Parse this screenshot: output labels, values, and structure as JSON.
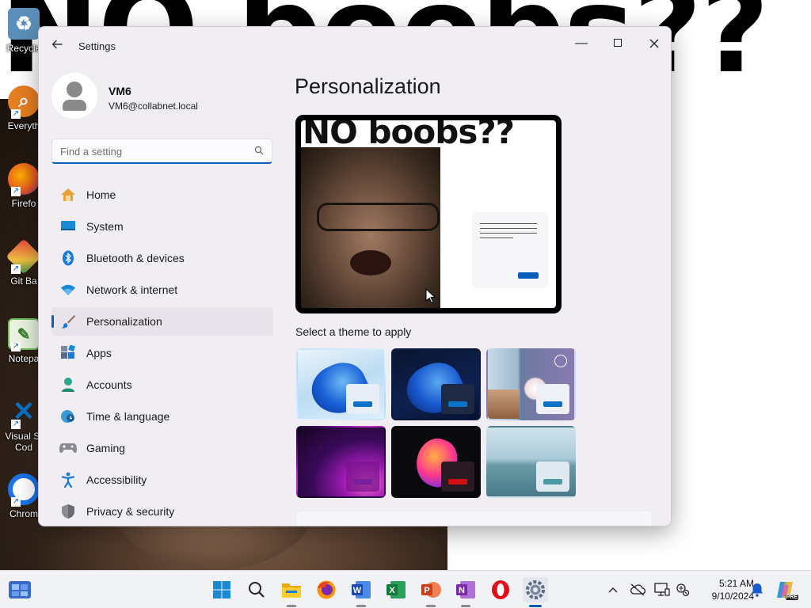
{
  "wallpaper": {
    "text": "NO boobs??"
  },
  "desktop_icons": [
    {
      "label": "Recycle",
      "icon": "recycle-bin-icon",
      "color": "#5b8fb9"
    },
    {
      "label": "Everyth",
      "icon": "search-everything-icon",
      "color": "#e67e22"
    },
    {
      "label": "Firefo",
      "icon": "firefox-icon",
      "color": "#e55b1f"
    },
    {
      "label": "Git Ba",
      "icon": "git-bash-icon",
      "color": "#c0392b"
    },
    {
      "label": "Notepa",
      "icon": "notepad-plus-icon",
      "color": "#6bbf59"
    },
    {
      "label": "Visual St",
      "label2": "Cod",
      "icon": "vscode-icon",
      "color": "#0a73c9"
    },
    {
      "label": "Chrom",
      "icon": "chrome-icon",
      "color": "#1a73e8"
    }
  ],
  "window": {
    "title": "Settings",
    "user": {
      "name": "VM6",
      "email": "VM6@collabnet.local"
    },
    "search": {
      "placeholder": "Find a setting"
    },
    "nav": [
      {
        "label": "Home",
        "icon": "home-icon"
      },
      {
        "label": "System",
        "icon": "system-icon"
      },
      {
        "label": "Bluetooth & devices",
        "icon": "bluetooth-icon"
      },
      {
        "label": "Network & internet",
        "icon": "wifi-icon"
      },
      {
        "label": "Personalization",
        "icon": "brush-icon",
        "selected": true
      },
      {
        "label": "Apps",
        "icon": "apps-icon"
      },
      {
        "label": "Accounts",
        "icon": "accounts-icon"
      },
      {
        "label": "Time & language",
        "icon": "globe-clock-icon"
      },
      {
        "label": "Gaming",
        "icon": "gamepad-icon"
      },
      {
        "label": "Accessibility",
        "icon": "accessibility-icon"
      },
      {
        "label": "Privacy & security",
        "icon": "shield-icon"
      }
    ],
    "page_title": "Personalization",
    "preview": {
      "wallpaper_text": "NO boobs??"
    },
    "themes_label": "Select a theme to apply",
    "themes": [
      {
        "name": "windows-light",
        "accent": "#0a73c9"
      },
      {
        "name": "windows-dark",
        "accent": "#0a73c9"
      },
      {
        "name": "windows-spotlight",
        "accent": "#0a73c9"
      },
      {
        "name": "glow",
        "accent": "#7a1fa0"
      },
      {
        "name": "captured-motion",
        "accent": "#d01010"
      },
      {
        "name": "flow",
        "accent": "#4a9aa6"
      }
    ]
  },
  "taskbar": {
    "apps": [
      {
        "name": "start-icon"
      },
      {
        "name": "search-icon"
      },
      {
        "name": "file-explorer-icon"
      },
      {
        "name": "firefox-icon"
      },
      {
        "name": "word-icon"
      },
      {
        "name": "excel-icon"
      },
      {
        "name": "powerpoint-icon"
      },
      {
        "name": "onenote-icon"
      },
      {
        "name": "opera-icon"
      },
      {
        "name": "settings-icon",
        "active": true
      }
    ],
    "tray": {
      "time": "5:21 AM",
      "date": "9/10/2024",
      "copilot_badge": "PRE"
    }
  }
}
